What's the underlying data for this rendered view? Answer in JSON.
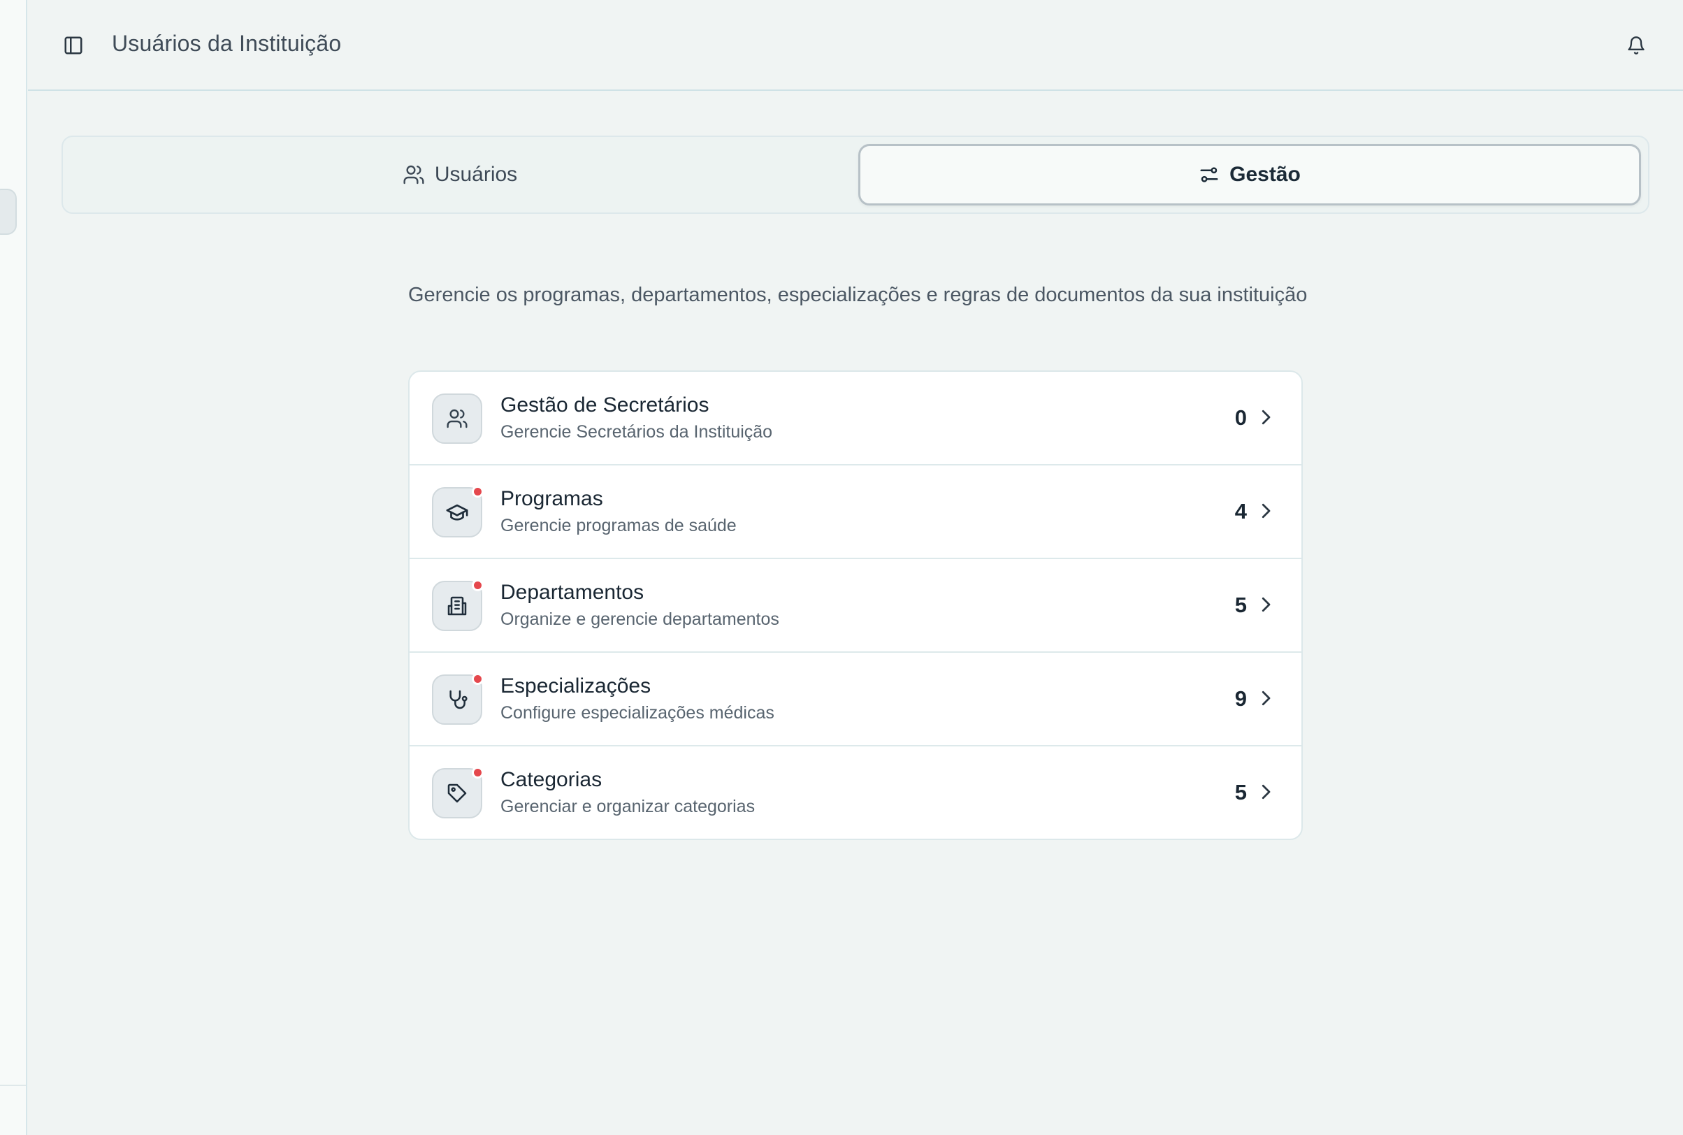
{
  "header": {
    "title": "Usuários da Instituição"
  },
  "tabs": [
    {
      "label": "Usuários",
      "active": false
    },
    {
      "label": "Gestão",
      "active": true
    }
  ],
  "description": "Gerencie os programas, departamentos, especializações e regras de documentos da sua instituição",
  "items": [
    {
      "title": "Gestão de Secretários",
      "subtitle": "Gerencie Secretários da Instituição",
      "count": "0",
      "icon": "users-icon",
      "dot": false
    },
    {
      "title": "Programas",
      "subtitle": "Gerencie programas de saúde",
      "count": "4",
      "icon": "graduation-cap-icon",
      "dot": true
    },
    {
      "title": "Departamentos",
      "subtitle": "Organize e gerencie departamentos",
      "count": "5",
      "icon": "building-icon",
      "dot": true
    },
    {
      "title": "Especializações",
      "subtitle": "Configure especializações médicas",
      "count": "9",
      "icon": "stethoscope-icon",
      "dot": true
    },
    {
      "title": "Categorias",
      "subtitle": "Gerenciar e organizar categorias",
      "count": "5",
      "icon": "tag-icon",
      "dot": true
    }
  ],
  "colors": {
    "background": "#f0f4f3",
    "card": "#ffffff",
    "notification_dot": "#e5484d",
    "text_primary": "#1a2733"
  }
}
